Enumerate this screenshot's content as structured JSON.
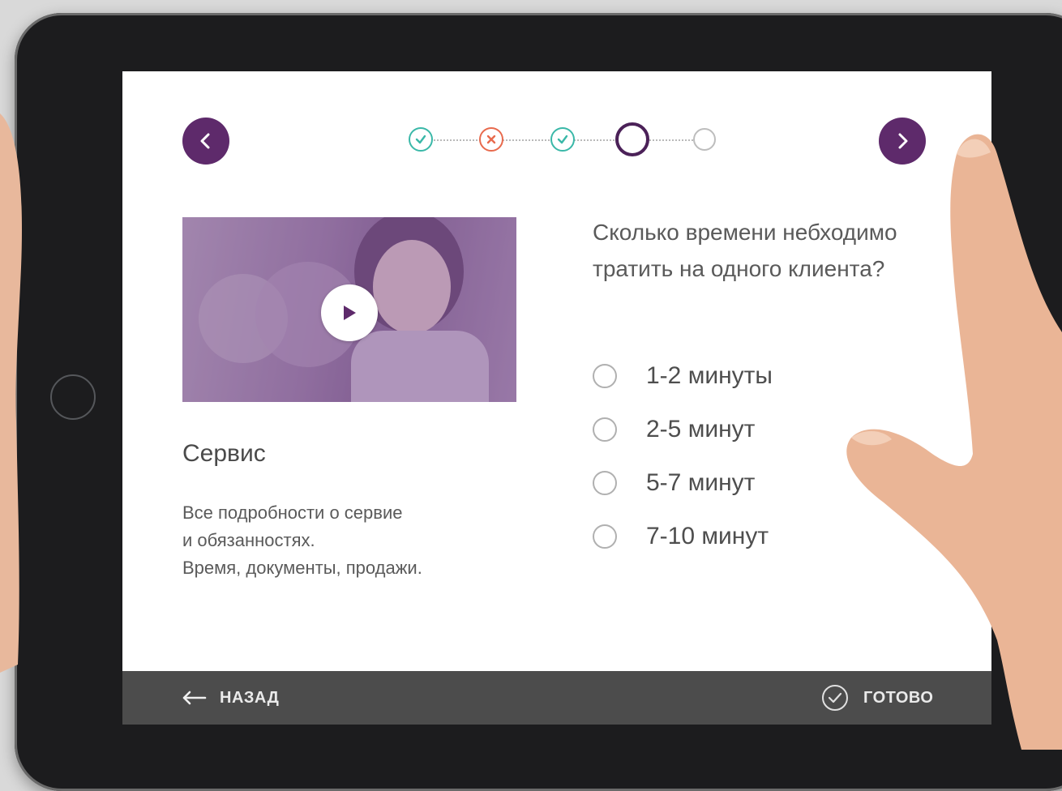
{
  "navigation": {
    "prev_icon": "chevron-left-icon",
    "next_icon": "chevron-right-icon"
  },
  "progress": {
    "steps": [
      {
        "state": "correct",
        "icon": "check-icon"
      },
      {
        "state": "wrong",
        "icon": "x-icon"
      },
      {
        "state": "correct",
        "icon": "check-icon"
      },
      {
        "state": "current",
        "icon": ""
      },
      {
        "state": "pending",
        "icon": ""
      }
    ],
    "current_step": 4,
    "total_steps": 5
  },
  "lesson": {
    "title": "Сервис",
    "description_lines": [
      "Все подробности о сервие",
      "и обязанностях.",
      "Время, документы, продажи."
    ],
    "play_icon": "play-icon"
  },
  "quiz": {
    "question": "Сколько времени небходимо тратить на одного клиента?",
    "options": [
      "1-2 минуты",
      "2-5 минут",
      "5-7 минут",
      "7-10 минут"
    ],
    "selected": null
  },
  "footer": {
    "back_label": "НАЗАД",
    "done_label": "ГОТОВО",
    "back_icon": "arrow-left-icon",
    "done_icon": "check-circle-icon"
  },
  "colors": {
    "accent": "#5e2a6b",
    "correct": "#3ab8a8",
    "wrong": "#e86a4d",
    "pending": "#bdbdbd",
    "footer_bg": "#4c4c4c"
  }
}
